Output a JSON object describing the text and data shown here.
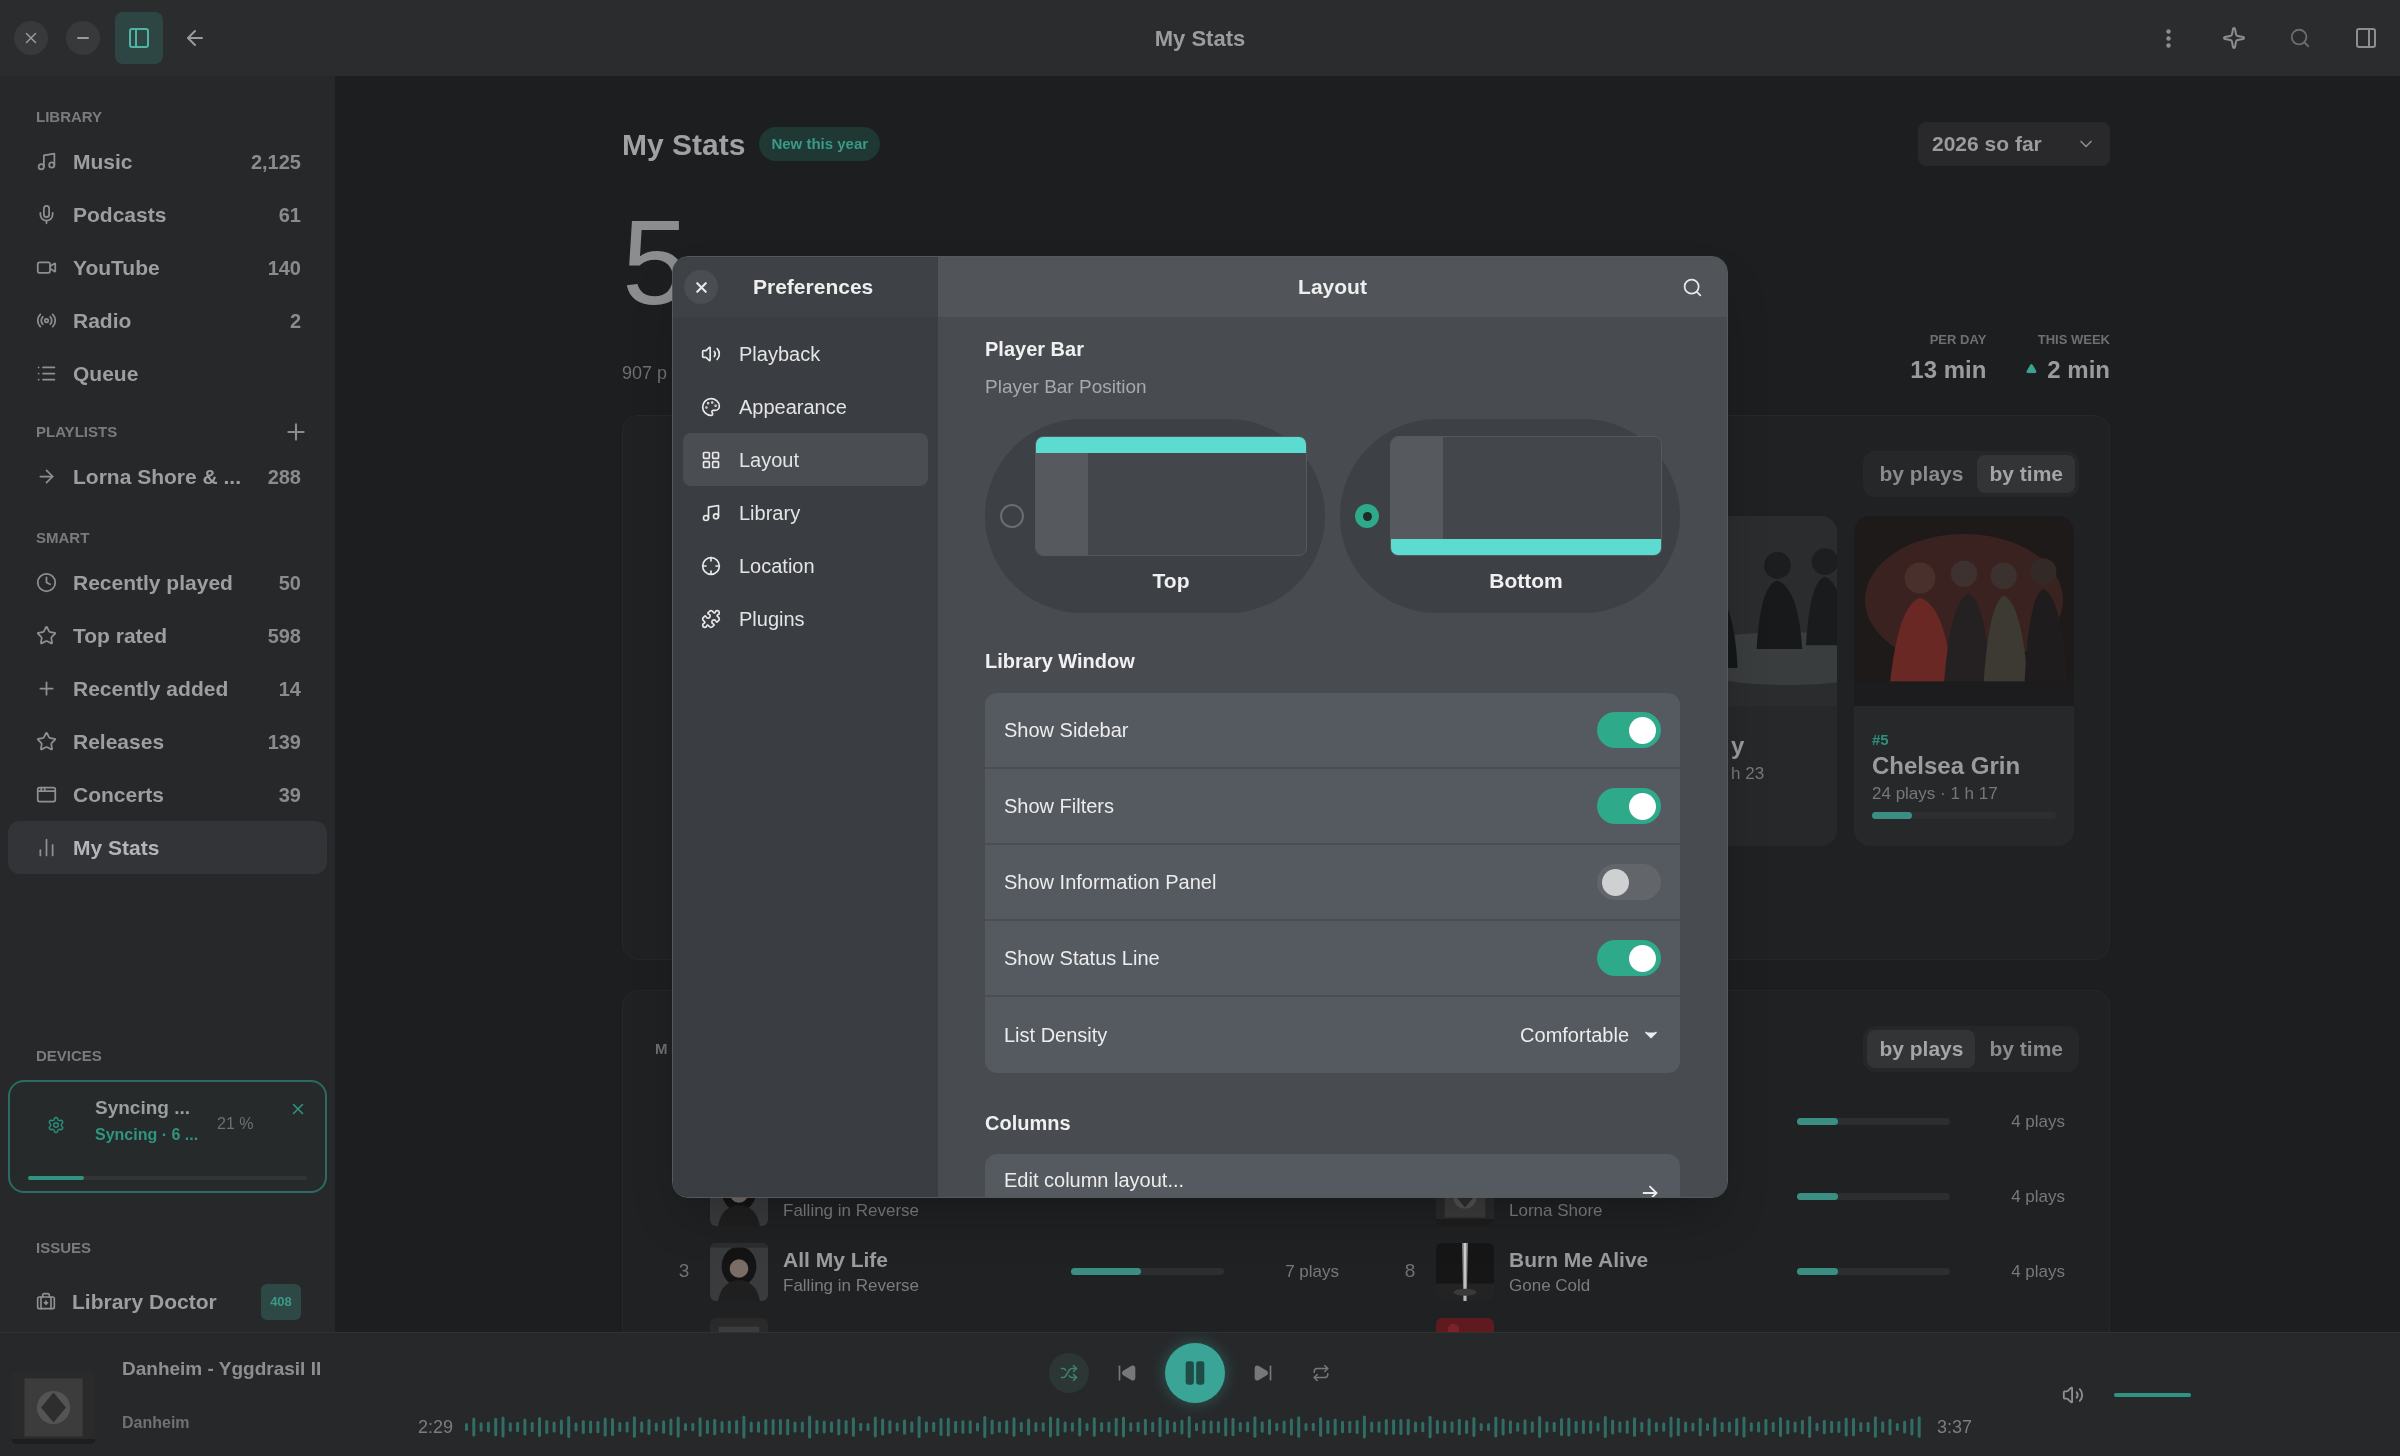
{
  "window": {
    "title": "My Stats",
    "sidebar_toggle_on": true
  },
  "sidebar": {
    "sections": [
      {
        "heading": "LIBRARY",
        "items": [
          {
            "label": "Music",
            "count": "2,125",
            "selected": false
          },
          {
            "label": "Podcasts",
            "count": "61",
            "selected": false
          },
          {
            "label": "YouTube",
            "count": "140",
            "selected": false
          },
          {
            "label": "Radio",
            "count": "2",
            "selected": false
          },
          {
            "label": "Queue",
            "selected": false
          }
        ]
      },
      {
        "heading": "PLAYLISTS",
        "has_add": true,
        "items": [
          {
            "label": "Lorna Shore & ...",
            "count": "288",
            "selected": false
          }
        ]
      },
      {
        "heading": "SMART",
        "items": [
          {
            "label": "Recently played",
            "count": "50",
            "selected": false
          },
          {
            "label": "Top rated",
            "count": "598",
            "selected": false
          },
          {
            "label": "Recently added",
            "count": "14",
            "selected": false
          },
          {
            "label": "Releases",
            "count": "139",
            "selected": false
          },
          {
            "label": "Concerts",
            "count": "39",
            "selected": false
          },
          {
            "label": "My Stats",
            "selected": true
          }
        ]
      }
    ],
    "devices": {
      "heading": "DEVICES",
      "device": {
        "title": "Syncing ...",
        "status": "Syncing · 6 ...",
        "percent": "21 %",
        "level": 0.2
      }
    },
    "issues": {
      "heading": "ISSUES",
      "items": [
        {
          "label": "Library Doctor",
          "badge": "408"
        }
      ]
    }
  },
  "stats": {
    "title": "My Stats",
    "badge": "New this year",
    "period": "2026 so far",
    "total": "5",
    "total_caption": "907 p",
    "figures": [
      {
        "label": "PER DAY",
        "value": "13 min"
      },
      {
        "label": "THIS WEEK",
        "value": "2 min",
        "trend_up": true
      }
    ],
    "top_artists": {
      "toggle": [
        {
          "label": "by plays",
          "selected": false
        },
        {
          "label": "by time",
          "selected": true
        }
      ],
      "cards": [
        {
          "name": "y",
          "detail": "h 23"
        },
        {
          "rank": "#5",
          "name": "Chelsea Grin",
          "detail": "24 plays · 1 h 17",
          "level": 0.22
        }
      ]
    },
    "top_tracks": {
      "heading": "M",
      "toggle": [
        {
          "label": "by plays",
          "selected": true
        },
        {
          "label": "by time",
          "selected": false
        }
      ],
      "columns": [
        [
          {},
          {
            "artist": "Falling in Reverse",
            "thumb": true
          },
          {
            "rank": "3",
            "title": "All My Life",
            "artist": "Falling in Reverse",
            "thumb": true,
            "level": 0.46,
            "plays": "7 plays"
          },
          {
            "thumb": true
          }
        ],
        [
          {
            "level": 0.27,
            "plays": "4 plays"
          },
          {
            "artist": "Lorna Shore",
            "thumb": true,
            "level": 0.27,
            "plays": "4 plays"
          },
          {
            "rank": "8",
            "title": "Burn Me Alive",
            "artist": "Gone Cold",
            "thumb": true,
            "level": 0.27,
            "plays": "4 plays"
          },
          {
            "thumb": true
          }
        ]
      ]
    }
  },
  "preferences": {
    "title": "Preferences",
    "page_title": "Layout",
    "nav": [
      {
        "label": "Playback",
        "selected": false
      },
      {
        "label": "Appearance",
        "selected": false
      },
      {
        "label": "Layout",
        "selected": true
      },
      {
        "label": "Library",
        "selected": false
      },
      {
        "label": "Location",
        "selected": false
      },
      {
        "label": "Plugins",
        "selected": false
      }
    ],
    "sections": [
      {
        "kind": "choice",
        "heading": "Player Bar",
        "subtitle": "Player Bar Position",
        "options": [
          {
            "kind": "top",
            "label": "Top",
            "selected": false
          },
          {
            "kind": "bottom",
            "label": "Bottom",
            "selected": true
          }
        ]
      },
      {
        "kind": "list",
        "heading": "Library Window",
        "rows": [
          {
            "kind": "switch",
            "label": "Show Sidebar",
            "on": true
          },
          {
            "kind": "switch",
            "label": "Show Filters",
            "on": true
          },
          {
            "kind": "switch",
            "label": "Show Information Panel",
            "on": false
          },
          {
            "kind": "switch",
            "label": "Show Status Line",
            "on": true
          },
          {
            "kind": "dropdown",
            "label": "List Density",
            "value": "Comfortable"
          }
        ]
      },
      {
        "kind": "list",
        "heading": "Columns",
        "rows": [
          {
            "kind": "link",
            "label": "Edit column layout..."
          }
        ]
      }
    ]
  },
  "player": {
    "title": "Danheim - Yggdrasil II",
    "artist": "Danheim",
    "elapsed": "2:29",
    "duration": "3:37",
    "playing": true,
    "shuffle_on": true,
    "volume": {
      "level": 1
    }
  }
}
